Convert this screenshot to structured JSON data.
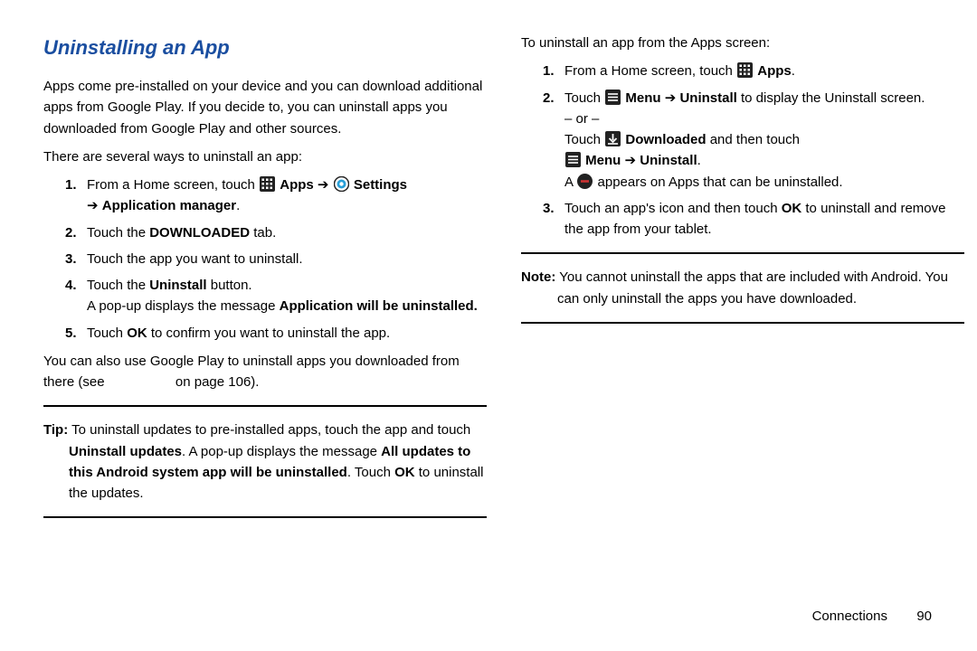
{
  "left": {
    "heading": "Uninstalling an App",
    "intro": "Apps come pre-installed on your device and you can download additional apps from Google Play. If you decide to, you can uninstall apps you downloaded from Google Play and other sources.",
    "ways": "There are several ways to uninstall an app:",
    "s1a": "From a Home screen, touch ",
    "s1_apps": " Apps ",
    "arrow": "➔",
    "s1_settings": " Settings",
    "s1b_arrow": "➔ ",
    "s1_appmgr": "Application manager",
    "s2a": "Touch the ",
    "s2_dl": "DOWNLOADED",
    "s2b": " tab.",
    "s3": "Touch the app you want to uninstall.",
    "s4a": "Touch the ",
    "s4_un": "Uninstall",
    "s4b": " button.",
    "s4c": "A pop-up displays the message ",
    "s4_msg": "Application will be uninstalled.",
    "s5a": "Touch ",
    "s5_ok": "OK",
    "s5b": " to confirm you want to uninstall the app.",
    "also_a": "You can also use Google Play to uninstall apps you downloaded from there (see ",
    "also_b": " on page 106).",
    "tip_label": "Tip:",
    "tip_a": " To uninstall updates to pre-installed apps, touch the app and touch ",
    "tip_b": "Uninstall updates",
    "tip_c": ". A pop-up displays the message ",
    "tip_d": "All updates to this Android system app will be uninstalled",
    "tip_e": ". Touch ",
    "tip_f": "OK",
    "tip_g": " to uninstall the updates."
  },
  "right": {
    "intro": "To uninstall an app from the Apps screen:",
    "r1a": "From a Home screen, touch ",
    "r1_apps": " Apps",
    "r2a": "Touch ",
    "r2_menu": " Menu ",
    "arrow": "➔",
    "r2_un": " Uninstall",
    "r2b": " to display the Uninstall screen.",
    "or": "– or –",
    "r2c": "Touch ",
    "r2_dl": " Downloaded",
    "r2d": " and then touch",
    "r2_menu2": " Menu ",
    "r2_un2": " Uninstall",
    "r2e": "A ",
    "r2f": " appears on Apps that can be uninstalled.",
    "r3a": "Touch an app's icon and then touch ",
    "r3_ok": "OK",
    "r3b": " to uninstall and remove the app from your tablet.",
    "note_label": "Note:",
    "note": " You cannot uninstall the apps that are included with Android. You can only uninstall the apps you have downloaded."
  },
  "footer": {
    "section": "Connections",
    "page": "90"
  },
  "nums": {
    "n1": "1.",
    "n2": "2.",
    "n3": "3.",
    "n4": "4.",
    "n5": "5."
  }
}
